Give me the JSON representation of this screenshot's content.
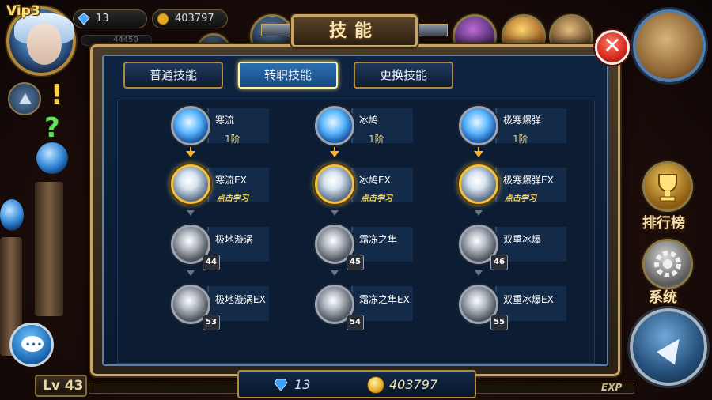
{
  "hud": {
    "vip": "Vip3",
    "gems": "13",
    "gold": "403797",
    "sub_value": "44450",
    "level_label": "Lv 43",
    "exp_label": "EXP",
    "side_labels": {
      "ranking": "排行榜",
      "system": "系统"
    },
    "ranking_icon": "trophy-icon",
    "system_icon": "gear-icon"
  },
  "panel": {
    "title": "技能",
    "close_label": "✕",
    "tabs": [
      {
        "label": "普通技能",
        "active": false
      },
      {
        "label": "转职技能",
        "active": true
      },
      {
        "label": "更换技能",
        "active": false
      }
    ]
  },
  "skills": {
    "col1": {
      "base": {
        "name": "寒流",
        "rank": "1阶"
      },
      "ex1": {
        "name": "寒流EX",
        "hint": "点击学习"
      },
      "t2": {
        "name": "极地漩涡",
        "level": "44"
      },
      "t3": {
        "name": "极地漩涡EX",
        "level": "53"
      }
    },
    "col2": {
      "base": {
        "name": "冰鸠",
        "rank": "1阶"
      },
      "ex1": {
        "name": "冰鸠EX",
        "hint": "点击学习"
      },
      "t2": {
        "name": "霜冻之隼",
        "level": "45"
      },
      "t3": {
        "name": "霜冻之隼EX",
        "level": "54"
      }
    },
    "col3": {
      "base": {
        "name": "极寒爆弹",
        "rank": "1阶"
      },
      "ex1": {
        "name": "极寒爆弹EX",
        "hint": "点击学习"
      },
      "t2": {
        "name": "双重冰爆",
        "level": "46"
      },
      "t3": {
        "name": "双重冰爆EX",
        "level": "55"
      }
    }
  },
  "footer": {
    "gems": "13",
    "gold": "403797"
  },
  "colors": {
    "accent_gold": "#c9a464",
    "panel_blue": "#0f2440",
    "active_tab": "#2b6fb0",
    "close_red": "#d42a1a",
    "hint_yellow": "#ffd24a"
  }
}
